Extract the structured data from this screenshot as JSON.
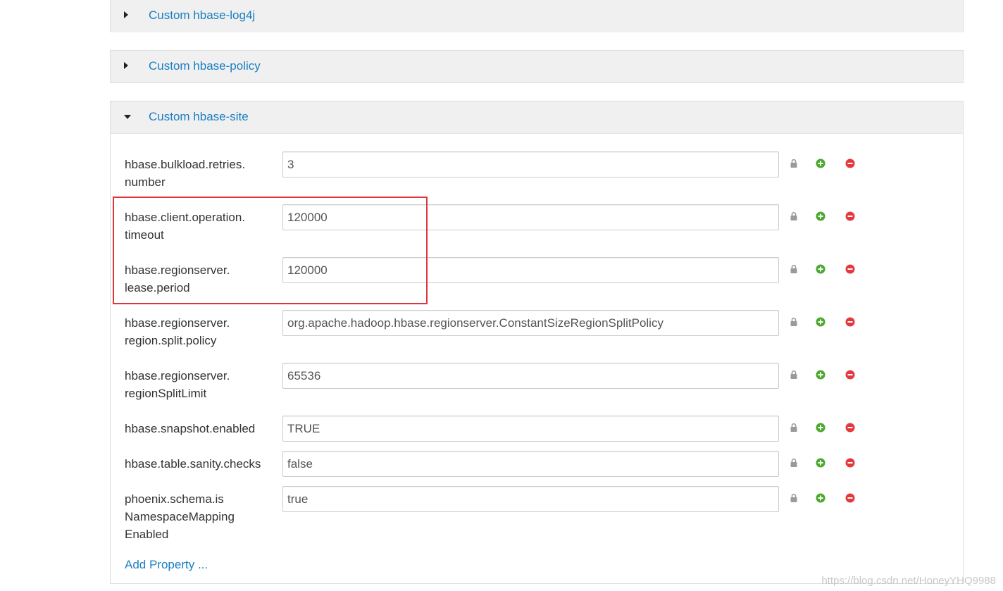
{
  "sections": {
    "log4j": {
      "title": "Custom hbase-log4j"
    },
    "policy": {
      "title": "Custom hbase-policy"
    },
    "site": {
      "title": "Custom hbase-site",
      "properties": [
        {
          "label": "hbase.bulkload.retries.\nnumber",
          "value": "3"
        },
        {
          "label": "hbase.client.operation.\ntimeout",
          "value": "120000"
        },
        {
          "label": "hbase.regionserver.\nlease.period",
          "value": "120000"
        },
        {
          "label": "hbase.regionserver.\nregion.split.policy",
          "value": "org.apache.hadoop.hbase.regionserver.ConstantSizeRegionSplitPolicy"
        },
        {
          "label": "hbase.regionserver.\nregionSplitLimit",
          "value": "65536"
        },
        {
          "label": "hbase.snapshot.enabled",
          "value": "TRUE"
        },
        {
          "label": "hbase.table.sanity.checks",
          "value": "false"
        },
        {
          "label": "phoenix.schema.is\nNamespaceMapping\nEnabled",
          "value": "true"
        }
      ],
      "add_property": "Add Property ..."
    }
  },
  "icons": {
    "lock": "lock-icon",
    "add": "plus-circle-icon",
    "remove": "minus-circle-icon"
  },
  "colors": {
    "link": "#1a7fc1",
    "add": "#4aa82c",
    "remove": "#e4393c",
    "lock": "#9a9a9a",
    "highlight": "#e0353a"
  },
  "watermark": "https://blog.csdn.net/HoneyYHQ9988"
}
